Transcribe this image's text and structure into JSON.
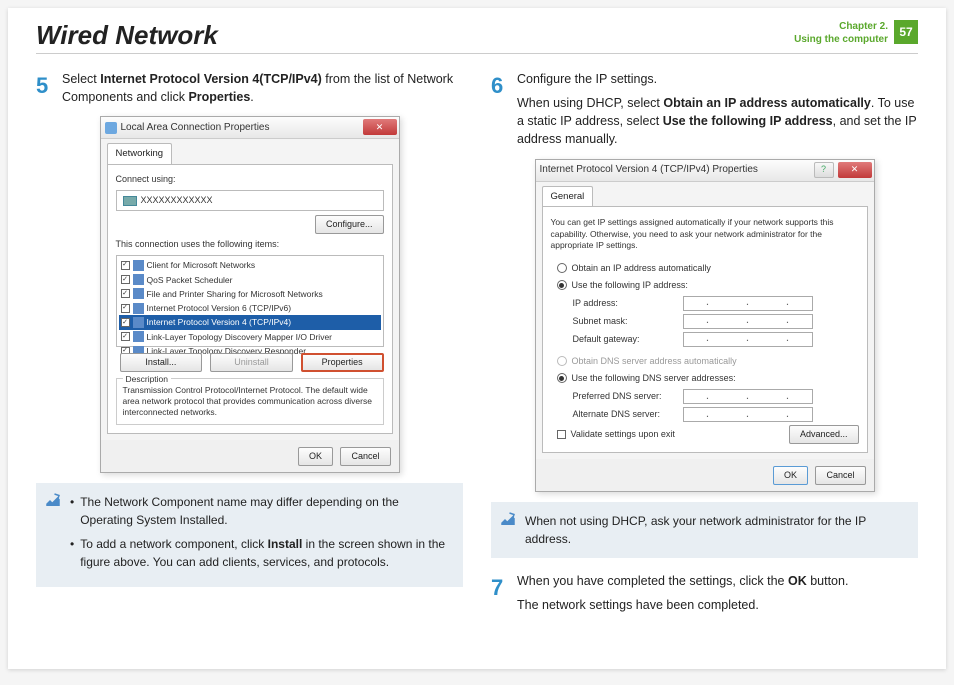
{
  "header": {
    "title": "Wired Network",
    "chapter_line1": "Chapter 2.",
    "chapter_line2": "Using the computer",
    "page_num": "57"
  },
  "step5": {
    "num": "5",
    "t1": "Select ",
    "b1": "Internet Protocol Version 4(TCP/IPv4)",
    "t2": " from the list of Network Components and click ",
    "b2": "Properties",
    "t3": "."
  },
  "note1": {
    "bullet1": "The Network Component name may differ depending on the Operating System Installed.",
    "bullet2_a": "To add a network component, click ",
    "bullet2_b": "Install",
    "bullet2_c": " in the screen shown in the figure above. You can add clients, services, and protocols."
  },
  "step6": {
    "num": "6",
    "line1": "Configure the IP settings.",
    "t1": "When using DHCP, select ",
    "b1": "Obtain an IP address automatically",
    "t2": ". To use a static IP address, select ",
    "b2": "Use the following IP address",
    "t3": ", and set the IP address manually."
  },
  "note2": {
    "text": "When not using DHCP, ask your network administrator for the IP address."
  },
  "step7": {
    "num": "7",
    "t1": "When you have completed the settings, click the ",
    "b1": "OK",
    "t2": " button.",
    "line2": "The network settings have been completed."
  },
  "dlg1": {
    "title": "Local Area Connection Properties",
    "tab": "Networking",
    "connect_lbl": "Connect using:",
    "adapter": "XXXXXXXXXXXX",
    "configure": "Configure...",
    "items_lbl": "This connection uses the following items:",
    "items": [
      "Client for Microsoft Networks",
      "QoS Packet Scheduler",
      "File and Printer Sharing for Microsoft Networks",
      "Internet Protocol Version 6 (TCP/IPv6)",
      "Internet Protocol Version 4 (TCP/IPv4)",
      "Link-Layer Topology Discovery Mapper I/O Driver",
      "Link-Layer Topology Discovery Responder"
    ],
    "install": "Install...",
    "uninstall": "Uninstall",
    "properties": "Properties",
    "desc_lbl": "Description",
    "desc": "Transmission Control Protocol/Internet Protocol. The default wide area network protocol that provides communication across diverse interconnected networks.",
    "ok": "OK",
    "cancel": "Cancel"
  },
  "dlg2": {
    "title": "Internet Protocol Version 4 (TCP/IPv4) Properties",
    "tab": "General",
    "info": "You can get IP settings assigned automatically if your network supports this capability. Otherwise, you need to ask your network administrator for the appropriate IP settings.",
    "r1": "Obtain an IP address automatically",
    "r2": "Use the following IP address:",
    "f_ip": "IP address:",
    "f_mask": "Subnet mask:",
    "f_gw": "Default gateway:",
    "r3": "Obtain DNS server address automatically",
    "r4": "Use the following DNS server addresses:",
    "f_dns1": "Preferred DNS server:",
    "f_dns2": "Alternate DNS server:",
    "validate": "Validate settings upon exit",
    "advanced": "Advanced...",
    "ok": "OK",
    "cancel": "Cancel"
  }
}
